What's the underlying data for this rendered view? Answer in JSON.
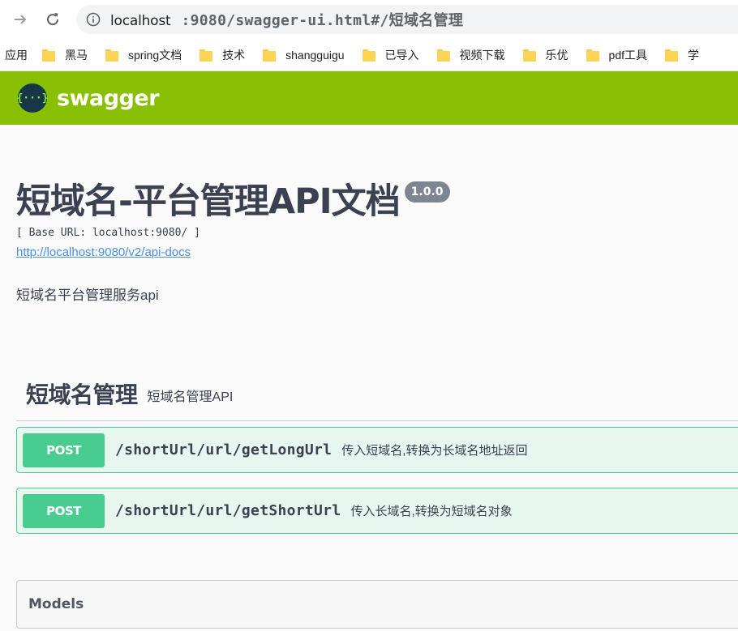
{
  "browser": {
    "url_host": "localhost",
    "url_rest": ":9080/swagger-ui.html#/短域名管理"
  },
  "bookmarks": {
    "apps_label": "应用",
    "items": [
      {
        "label": "黑马"
      },
      {
        "label": "spring文档"
      },
      {
        "label": "技术"
      },
      {
        "label": "shangguigu"
      },
      {
        "label": "已导入"
      },
      {
        "label": "视频下载"
      },
      {
        "label": "乐优"
      },
      {
        "label": "pdf工具"
      },
      {
        "label": "学"
      }
    ]
  },
  "header": {
    "logo_glyph": "{···}",
    "brand": "swagger",
    "color": "#89bf04"
  },
  "info": {
    "title": "短域名-平台管理API文档",
    "version": "1.0.0",
    "base_url": "[ Base URL: localhost:9080/ ]",
    "docs_link": "http://localhost:9080/v2/api-docs",
    "description": "短域名平台管理服务api"
  },
  "tag": {
    "name": "短域名管理",
    "description": "短域名管理API"
  },
  "operations": [
    {
      "method": "POST",
      "path": "/shortUrl/url/getLongUrl",
      "summary": "传入短域名,转换为长域名地址返回"
    },
    {
      "method": "POST",
      "path": "/shortUrl/url/getShortUrl",
      "summary": "传入长域名,转换为短域名对象"
    }
  ],
  "models": {
    "title": "Models"
  }
}
